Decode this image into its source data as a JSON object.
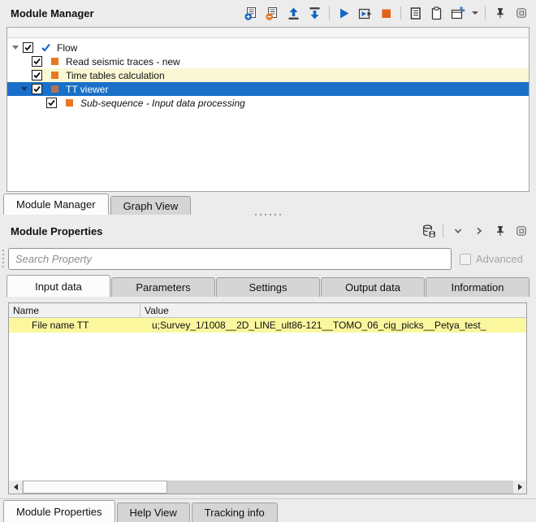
{
  "module_manager": {
    "title": "Module Manager",
    "toolbar": {
      "buttons": [
        "add-module",
        "remove-module",
        "move-to-top",
        "move-to-bottom",
        "run-flow",
        "run-flow-interactive",
        "stop-flow",
        "flow-report",
        "paste",
        "new-flow-window",
        "window-menu-caret",
        "pin-panel",
        "float-panel"
      ]
    },
    "tree": {
      "rows": [
        {
          "label": "Flow",
          "level": 0,
          "checked": true,
          "icon": "flow-check",
          "state": "normal",
          "expanded": true
        },
        {
          "label": "Read seismic traces - new",
          "level": 1,
          "checked": true,
          "icon": "module-square",
          "state": "normal"
        },
        {
          "label": "Time tables calculation",
          "level": 1,
          "checked": true,
          "icon": "module-square",
          "state": "highlighted"
        },
        {
          "label": "TT viewer",
          "level": 1,
          "checked": true,
          "icon": "module-square",
          "state": "selected",
          "expanded": true
        },
        {
          "label": "Sub-sequence - Input data processing",
          "level": 2,
          "checked": true,
          "icon": "module-square",
          "state": "normal",
          "style": "italic"
        }
      ]
    },
    "tabs": [
      {
        "label": "Module Manager",
        "active": true
      },
      {
        "label": "Graph View",
        "active": false
      }
    ]
  },
  "module_properties": {
    "title": "Module Properties",
    "toolbar": {
      "buttons": [
        "save-to-database",
        "chevron-down",
        "chevron-right",
        "pin-panel",
        "float-panel"
      ]
    },
    "search": {
      "placeholder": "Search Property",
      "value": ""
    },
    "advanced": {
      "label": "Advanced",
      "checked": false,
      "enabled": false
    },
    "tabs": [
      {
        "label": "Input data",
        "active": true
      },
      {
        "label": "Parameters",
        "active": false
      },
      {
        "label": "Settings",
        "active": false
      },
      {
        "label": "Output data",
        "active": false
      },
      {
        "label": "Information",
        "active": false
      }
    ],
    "table": {
      "columns": [
        "Name",
        "Value"
      ],
      "rows": [
        {
          "name": "File name TT",
          "value": "u;Survey_1/1008__2D_LINE_ult86-121__TOMO_06_cig_picks__Petya_test_",
          "highlighted": true
        }
      ]
    },
    "bottom_tabs": [
      {
        "label": "Module Properties",
        "active": true
      },
      {
        "label": "Help View",
        "active": false
      },
      {
        "label": "Tracking info",
        "active": false
      }
    ]
  },
  "colors": {
    "selection_blue": "#1a70c8",
    "module_orange": "#e87722",
    "tree_highlight_yellow": "#faf8d4",
    "table_highlight_yellow": "#fbf79e",
    "icon_blue": "#1565c0",
    "stop_orange": "#e2601a"
  }
}
